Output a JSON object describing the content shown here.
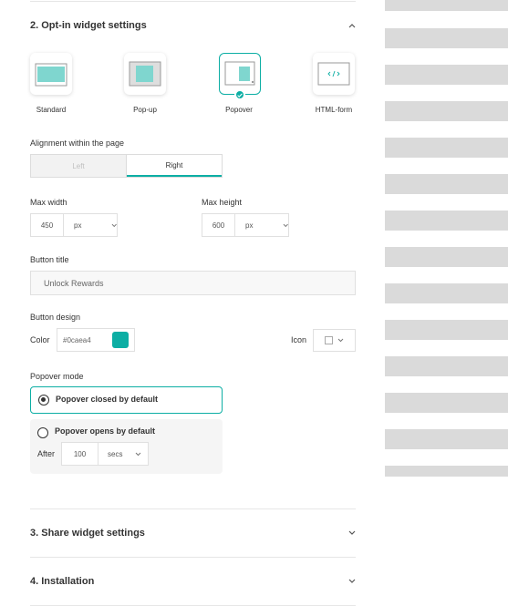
{
  "section2": {
    "title": "2. Opt-in widget settings"
  },
  "widget_types": [
    {
      "label": "Standard",
      "active": false
    },
    {
      "label": "Pop-up",
      "active": false
    },
    {
      "label": "Popover",
      "active": true
    },
    {
      "label": "HTML-form",
      "active": false
    }
  ],
  "alignment": {
    "label": "Alignment within the page",
    "options": [
      "Left",
      "Right"
    ],
    "selected": "Right"
  },
  "max_width": {
    "label": "Max width",
    "value": "450",
    "unit": "px"
  },
  "max_height": {
    "label": "Max height",
    "value": "600",
    "unit": "px"
  },
  "button_title": {
    "label": "Button title",
    "value": "Unlock Rewards"
  },
  "button_design": {
    "label": "Button design",
    "color_label": "Color",
    "color_value": "#0caea4",
    "icon_label": "Icon"
  },
  "popover_mode": {
    "label": "Popover mode",
    "options": [
      {
        "label": "Popover closed by default",
        "selected": true
      },
      {
        "label": "Popover opens by default",
        "selected": false
      }
    ],
    "after_label": "After",
    "after_value": "100",
    "after_unit": "secs"
  },
  "section3": {
    "title": "3. Share widget settings"
  },
  "section4": {
    "title": "4. Installation"
  },
  "colors": {
    "accent": "#0caea4",
    "placeholder_stripe": "#dadada"
  }
}
